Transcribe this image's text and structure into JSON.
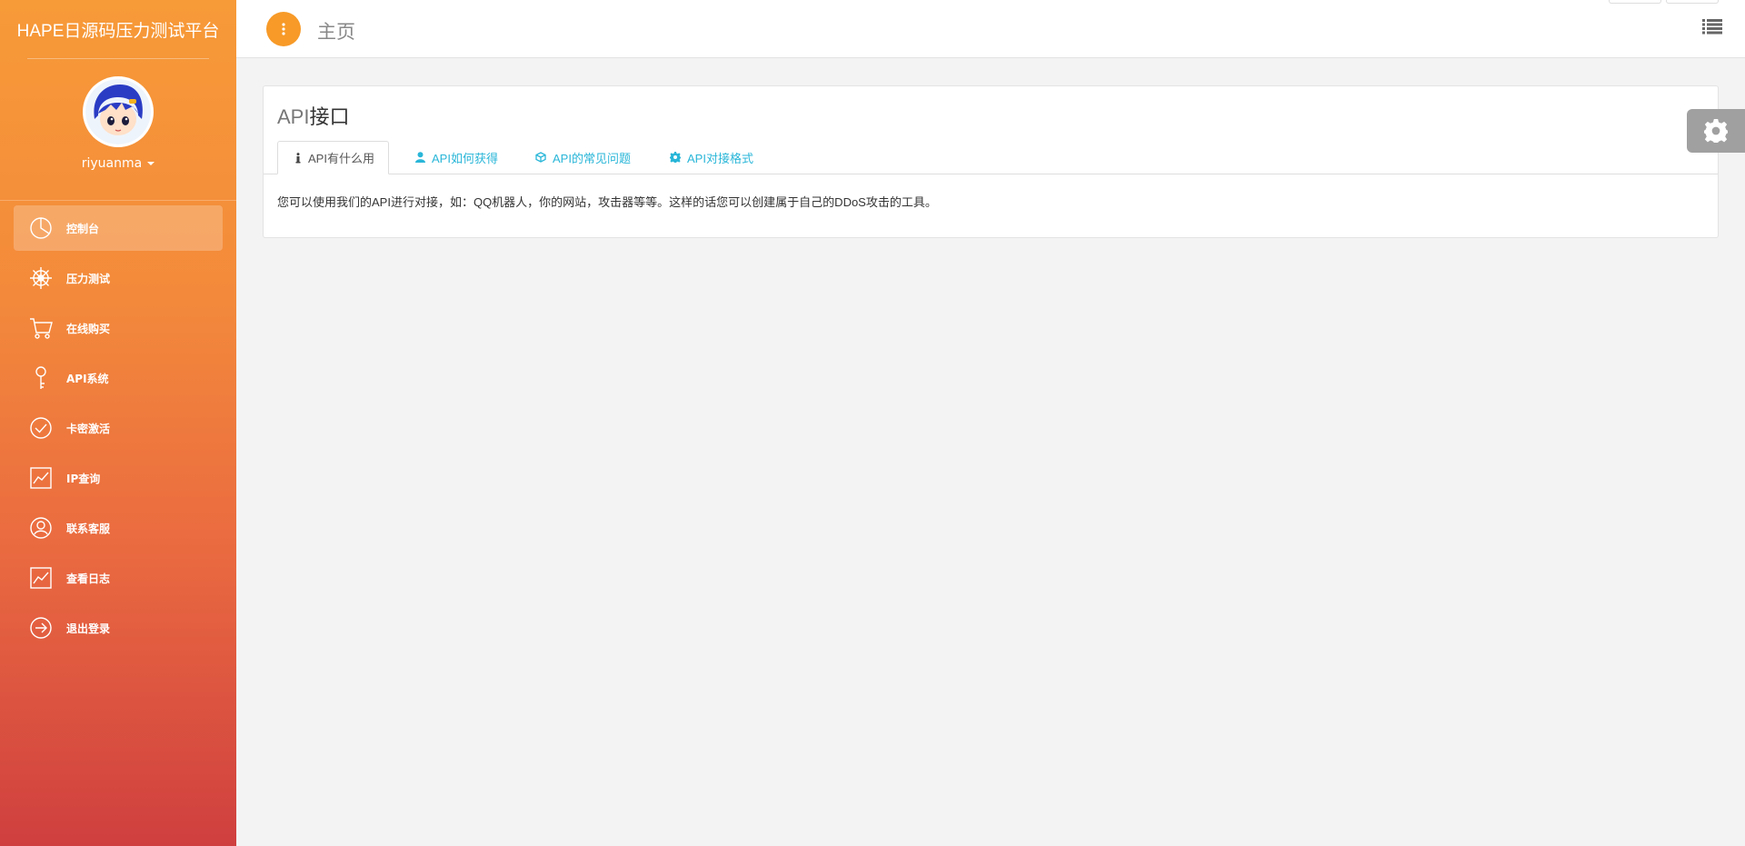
{
  "sidebar": {
    "brand": "HAPE日源码压力测试平台",
    "username": "riyuanma",
    "items": [
      {
        "label": "控制台",
        "icon": "dashboard-pie-icon"
      },
      {
        "label": "压力测试",
        "icon": "ship-wheel-icon"
      },
      {
        "label": "在线购买",
        "icon": "cart-icon"
      },
      {
        "label": "API系统",
        "icon": "key-icon"
      },
      {
        "label": "卡密激活",
        "icon": "check-circle-icon"
      },
      {
        "label": "IP查询",
        "icon": "line-chart-icon"
      },
      {
        "label": "联系客服",
        "icon": "user-circle-icon"
      },
      {
        "label": "查看日志",
        "icon": "line-chart-icon"
      },
      {
        "label": "退出登录",
        "icon": "arrow-right-circle-icon"
      }
    ]
  },
  "header": {
    "title": "主页"
  },
  "panel": {
    "title_prefix": "API",
    "title_rest": "接口",
    "tabs": [
      {
        "label": "API有什么用",
        "icon": "info-icon"
      },
      {
        "label": "API如何获得",
        "icon": "user-icon"
      },
      {
        "label": "API的常见问题",
        "icon": "cube-icon"
      },
      {
        "label": "API对接格式",
        "icon": "gear-icon"
      }
    ],
    "content": "您可以使用我们的API进行对接，如：QQ机器人，你的网站，攻击器等等。这样的话您可以创建属于自己的DDoS攻击的工具。"
  },
  "colors": {
    "sidebar_top": "#f79a38",
    "sidebar_bottom": "#cf3f3f",
    "accent": "#f79a28",
    "tab_link": "#29b6d8"
  }
}
